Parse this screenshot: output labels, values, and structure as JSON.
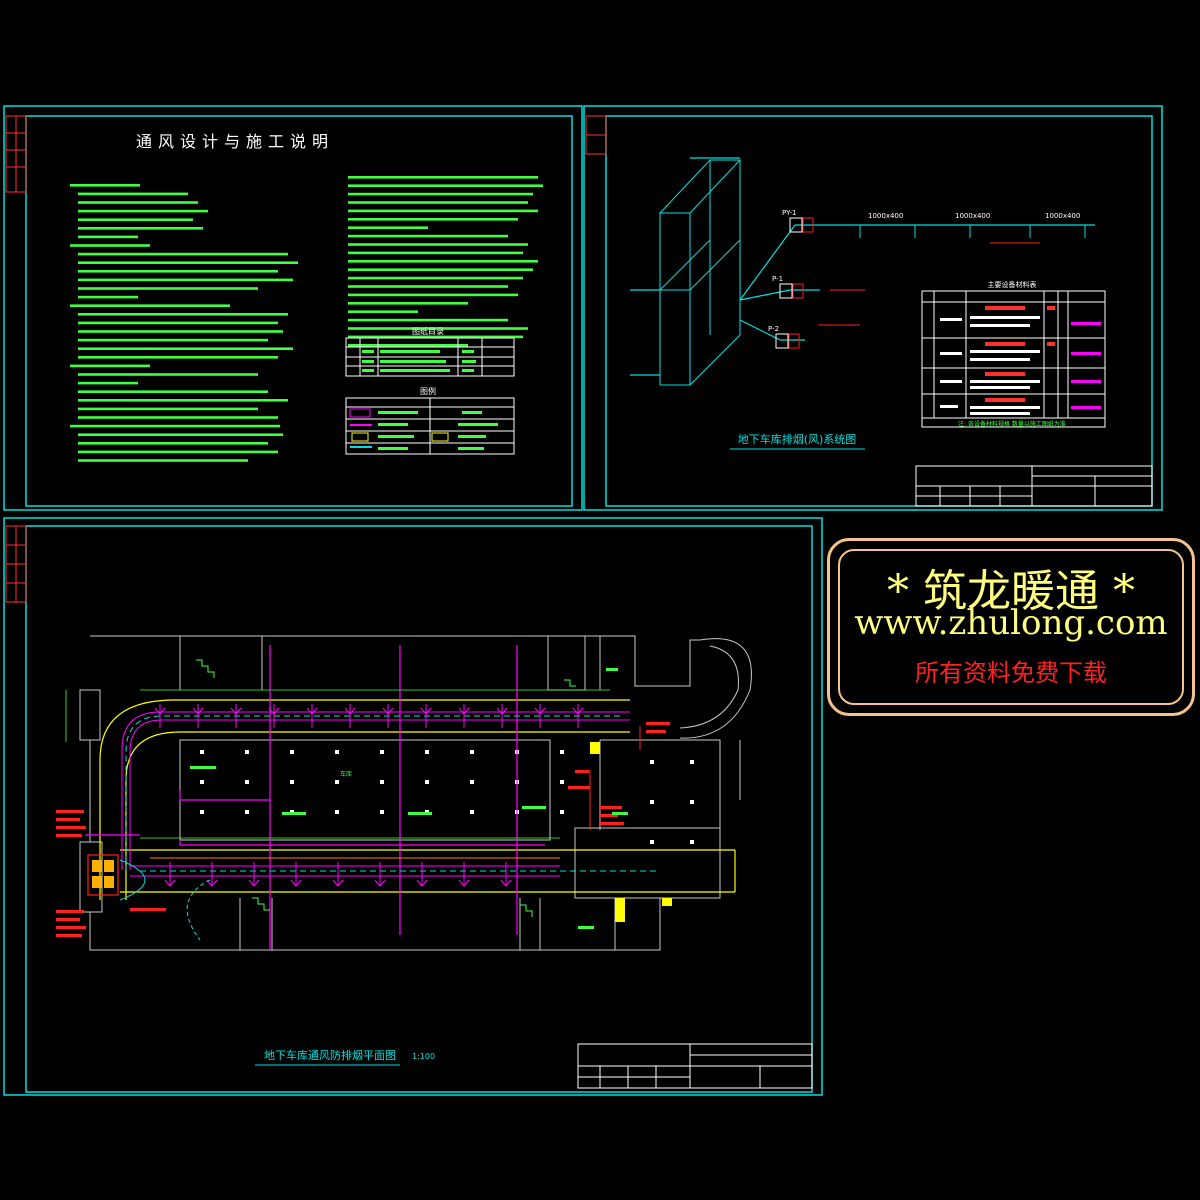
{
  "sheets": {
    "notes_title": "通风设计与施工说明",
    "system_title": "地下车库排烟(风)系统图",
    "plan_title": "地下车库通风防排烟平面图",
    "plan_scale": "1:100",
    "drawing_list_title": "图纸目录",
    "legend_title": "图例",
    "equipment_table_title": "主要设备材料表",
    "equipment_table_note": "注: 各设备材料规格 数量以施工图纸为准"
  },
  "system_labels": {
    "duct_1": "1000x400",
    "duct_2": "1000x400",
    "duct_3": "1000x400",
    "fan_1": "PY-1",
    "fan_2": "P-1",
    "fan_3": "P-2"
  },
  "plan_labels": {
    "area_label": "车库"
  },
  "banner": {
    "title": "* 筑龙暖通 *",
    "url": "www.zhulong.com",
    "subtitle": "所有资料免费下载"
  },
  "colors": {
    "frame": "#00e0e0",
    "duct": "#ff00ff",
    "text_green": "#40ff40",
    "highlight": "#ffff00",
    "red": "#ff2020"
  }
}
